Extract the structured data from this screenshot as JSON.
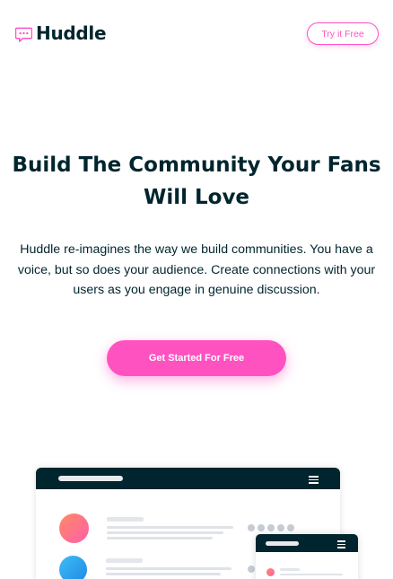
{
  "header": {
    "logo_text": "Huddle",
    "logo_icon": "speech-bubble-icon",
    "try_button_label": "Try it Free"
  },
  "hero": {
    "title_line1": "Build The Community Your Fans",
    "title_line2": "Will Love",
    "description": "Huddle re-imagines the way we build communities. You have a voice, but so does your audience. Create connections with your users as you engage in genuine discussion.",
    "cta_label": "Get Started For Free"
  },
  "illustration": {
    "type": "app-mockup",
    "menu_icon": "hamburger-menu-icon"
  },
  "colors": {
    "brand_pink": "#ff52c1",
    "dark_navy": "#00252e",
    "avatar_gradient_orange": [
      "#ff8a65",
      "#ff5fa8"
    ],
    "avatar_gradient_blue": [
      "#3ebdf7",
      "#1e88e5"
    ]
  }
}
